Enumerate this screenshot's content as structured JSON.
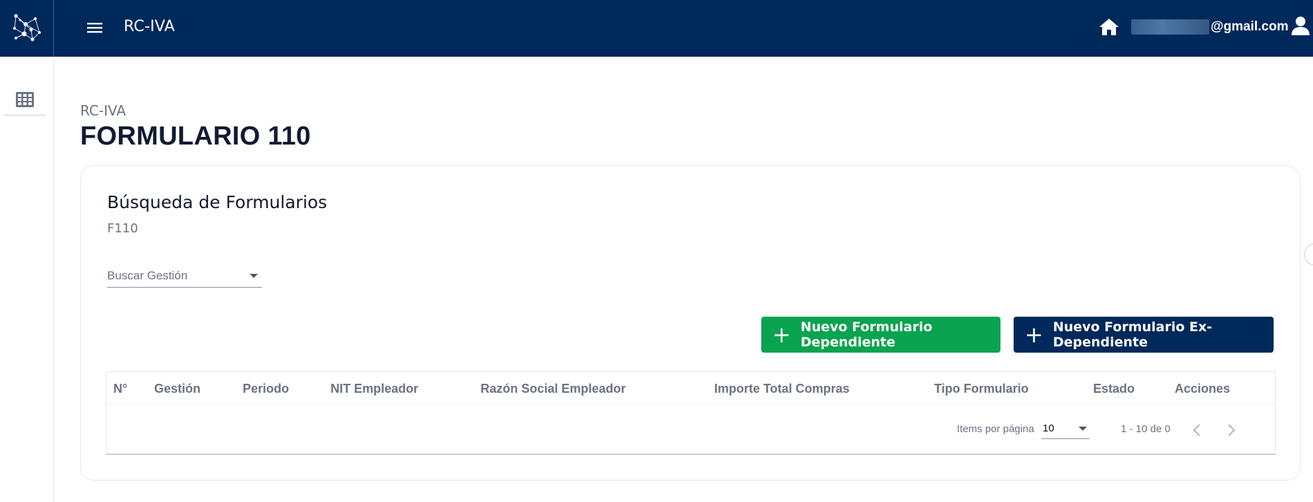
{
  "header": {
    "app_title": "RC-IVA",
    "user_email_suffix": "@gmail.com",
    "icons": {
      "logo": "network-logo-icon",
      "menu": "hamburger-menu-icon",
      "home": "home-icon",
      "user": "user-icon"
    }
  },
  "sidebar": {
    "items": [
      {
        "icon": "grid-table-icon"
      }
    ]
  },
  "page": {
    "breadcrumb": "RC-IVA",
    "title": "FORMULARIO 110"
  },
  "card": {
    "title": "Búsqueda de Formularios",
    "subtitle": "F110",
    "search_select": {
      "placeholder": "Buscar Gestión"
    },
    "buttons": {
      "new_dependent": "Nuevo Formulario Dependiente",
      "new_ex_dependent": "Nuevo Formulario Ex-Dependiente"
    },
    "table": {
      "columns": [
        "N°",
        "Gestión",
        "Periodo",
        "NIT Empleador",
        "Razón Social Empleador",
        "Importe Total Compras",
        "Tipo Formulario",
        "Estado",
        "Acciones"
      ],
      "rows": []
    },
    "paginator": {
      "items_per_page_label": "Items por página",
      "page_size": "10",
      "range": "1 - 10 de 0"
    }
  },
  "colors": {
    "topbar": "#00295b",
    "primary_navy": "#00295b",
    "success_green": "#0aa34f"
  }
}
